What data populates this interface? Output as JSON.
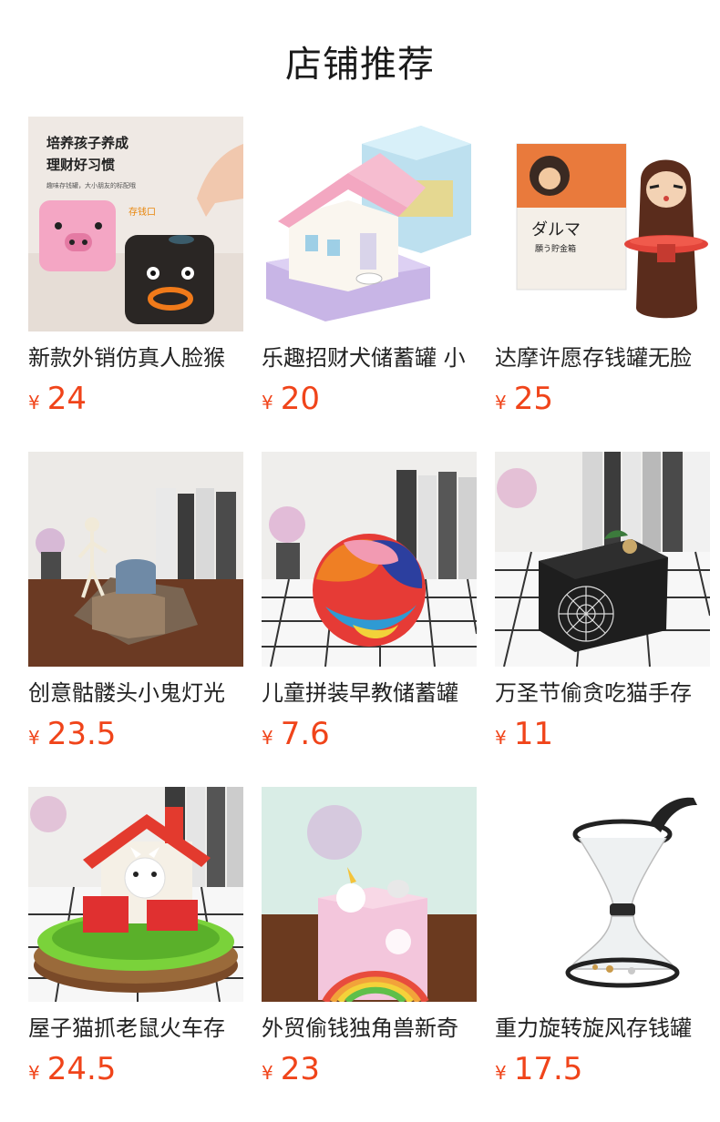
{
  "section_title": "店铺推荐",
  "products": [
    {
      "name": "新款外销仿真人脸猴",
      "currency": "¥",
      "price": "24",
      "image": "pig-and-black-box-banks"
    },
    {
      "name": "乐趣招财犬储蓄罐 小",
      "currency": "¥",
      "price": "20",
      "image": "pink-house-bank"
    },
    {
      "name": "达摩许愿存钱罐无脸",
      "currency": "¥",
      "price": "25",
      "image": "daruma-bank"
    },
    {
      "name": "创意骷髅头小鬼灯光",
      "currency": "¥",
      "price": "23.5",
      "image": "skeleton-graveyard-bank"
    },
    {
      "name": "儿童拼装早教储蓄罐",
      "currency": "¥",
      "price": "7.6",
      "image": "puzzle-ball-bank"
    },
    {
      "name": "万圣节偷贪吃猫手存",
      "currency": "¥",
      "price": "11",
      "image": "spiderweb-box-bank"
    },
    {
      "name": "屋子猫抓老鼠火车存",
      "currency": "¥",
      "price": "24.5",
      "image": "cat-house-train-bank"
    },
    {
      "name": "外贸偷钱独角兽新奇",
      "currency": "¥",
      "price": "23",
      "image": "unicorn-box-bank"
    },
    {
      "name": "重力旋转旋风存钱罐",
      "currency": "¥",
      "price": "17.5",
      "image": "gravity-funnel-bank"
    }
  ],
  "image_text": {
    "p1_headline_1": "培养孩子养成",
    "p1_headline_2": "理财好习惯",
    "p1_sub": "趣味存钱罐，大小朋友的标配哦",
    "p1_tag": "存钱口",
    "p3_box_title": "ダルマ",
    "p3_box_sub": "願う貯金箱"
  },
  "colors": {
    "price": "#f0441a",
    "title": "#1a1a1a"
  }
}
